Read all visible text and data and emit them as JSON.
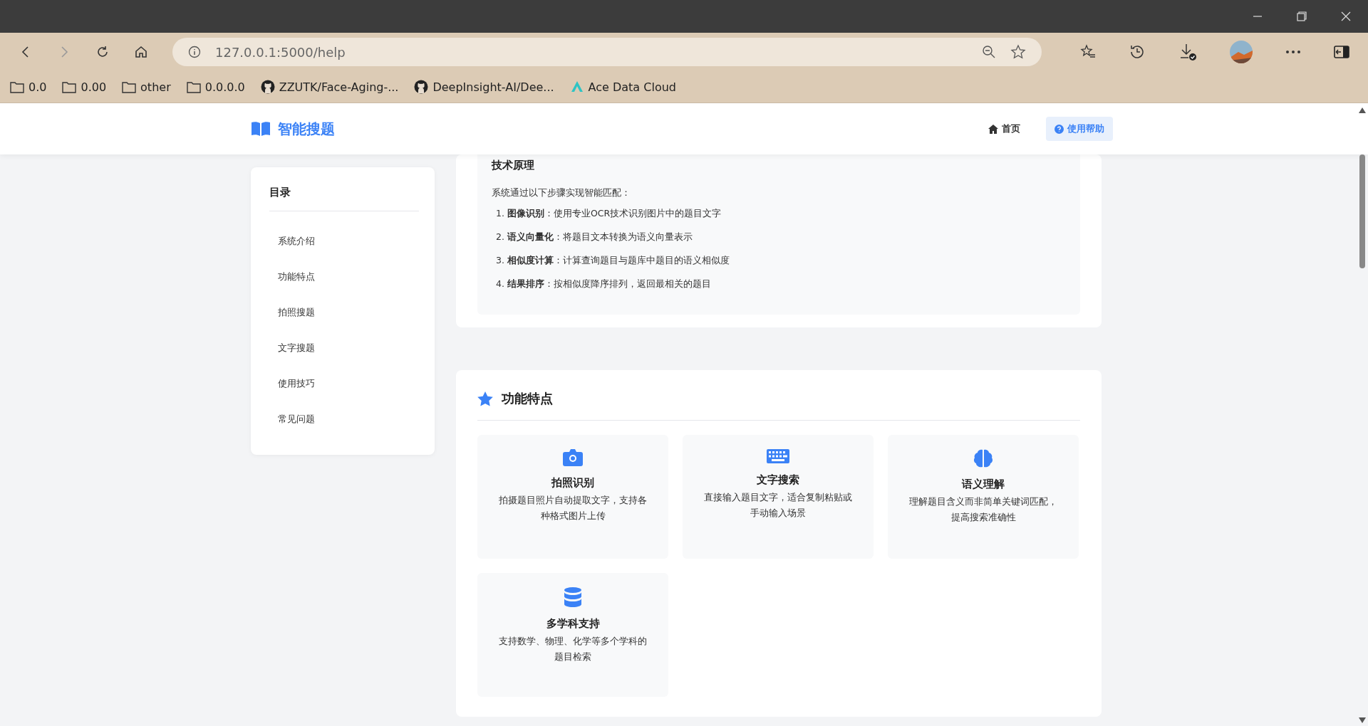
{
  "browser": {
    "url": "127.0.0.1:5000/help",
    "bookmarks": [
      {
        "kind": "folder",
        "label": "0.0"
      },
      {
        "kind": "folder",
        "label": "0.00"
      },
      {
        "kind": "folder",
        "label": "other"
      },
      {
        "kind": "folder",
        "label": "0.0.0.0"
      },
      {
        "kind": "github",
        "label": "ZZUTK/Face-Aging-..."
      },
      {
        "kind": "github",
        "label": "DeepInsight-AI/Dee..."
      },
      {
        "kind": "ace",
        "label": "Ace Data Cloud"
      }
    ]
  },
  "header": {
    "brand": "智能搜题",
    "nav": [
      {
        "kind": "home",
        "label": "首页",
        "selected": false
      },
      {
        "kind": "help",
        "label": "使用帮助",
        "selected": true
      }
    ]
  },
  "toc": {
    "title": "目录",
    "items": [
      "系统介绍",
      "功能特点",
      "拍照搜题",
      "文字搜题",
      "使用技巧",
      "常见问题"
    ]
  },
  "tech": {
    "title": "技术原理",
    "intro": "系统通过以下步骤实现智能匹配：",
    "steps": [
      {
        "marker": "1.",
        "text": "**图像识别**：使用专业OCR技术识别图片中的题目文字"
      },
      {
        "marker": "2.",
        "text": "**语义向量化**：将题目文本转换为语义向量表示"
      },
      {
        "marker": "3.",
        "text": "**相似度计算**：计算查询题目与题库中题目的语义相似度"
      },
      {
        "marker": "4.",
        "text": "**结果排序**：按相似度降序排列，返回最相关的题目"
      }
    ]
  },
  "features": {
    "title": "功能特点",
    "items": [
      {
        "kind": "camera",
        "title": "拍照识别",
        "text": "拍摄题目照片自动提取文字，支持各种格式图片上传"
      },
      {
        "kind": "keyboard",
        "title": "文字搜索",
        "text": "直接输入题目文字，适合复制粘贴或手动输入场景"
      },
      {
        "kind": "brain",
        "title": "语义理解",
        "text": "理解题目含义而非简单关键词匹配，提高搜索准确性"
      },
      {
        "kind": "database",
        "title": "多学科支持",
        "text": "支持数学、物理、化学等多个学科的题目检索"
      }
    ]
  }
}
